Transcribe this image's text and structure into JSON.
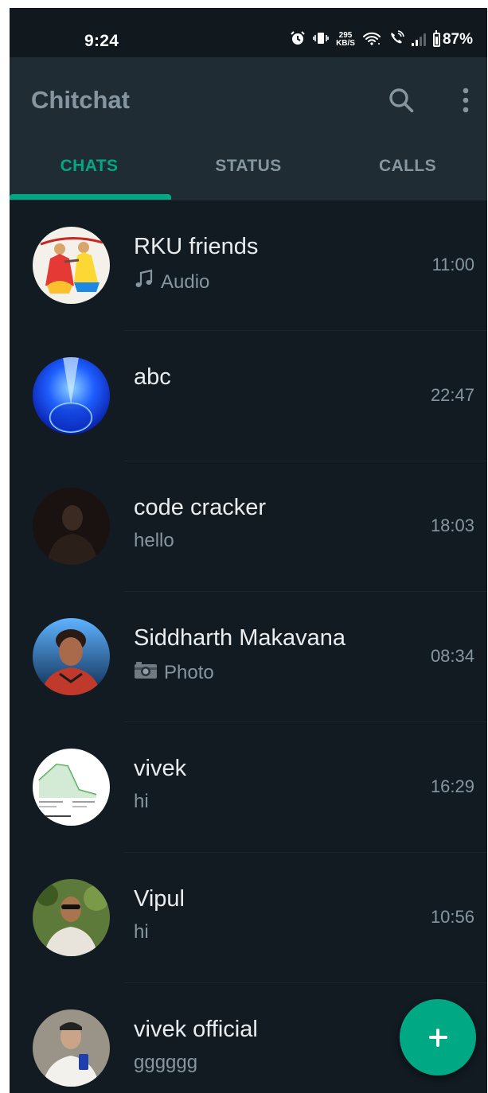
{
  "status_bar": {
    "time": "9:24",
    "net_speed_value": "295",
    "net_speed_unit": "KB/S",
    "battery": "87%",
    "icons": [
      "alarm-icon",
      "vibrate-icon",
      "wifi-icon",
      "wifi-call-icon",
      "signal-icon",
      "battery-icon"
    ]
  },
  "app_bar": {
    "title": "Chitchat",
    "icons": [
      "search-icon",
      "more-vert-icon"
    ]
  },
  "tabs": [
    {
      "label": "CHATS",
      "active": true
    },
    {
      "label": "STATUS",
      "active": false
    },
    {
      "label": "CALLS",
      "active": false
    }
  ],
  "chats": [
    {
      "name": "RKU friends",
      "preview": "Audio",
      "preview_icon": "music-note-icon",
      "time": "11:00"
    },
    {
      "name": "abc",
      "preview": "",
      "time": "22:47"
    },
    {
      "name": "code cracker",
      "preview": "hello",
      "time": "18:03"
    },
    {
      "name": "Siddharth Makavana",
      "preview": "Photo",
      "preview_icon": "camera-icon",
      "time": "08:34"
    },
    {
      "name": "vivek",
      "preview": "hi",
      "time": "16:29"
    },
    {
      "name": "Vipul",
      "preview": "hi",
      "time": "10:56"
    },
    {
      "name": "vivek official",
      "preview": "gggggg",
      "time": ""
    }
  ],
  "fab": {
    "icon": "plus-icon"
  },
  "colors": {
    "accent": "#00a884",
    "background": "#121b22",
    "app_bar": "#1f2c34",
    "secondary_text": "#8696a0",
    "primary_text": "#e9edef"
  }
}
